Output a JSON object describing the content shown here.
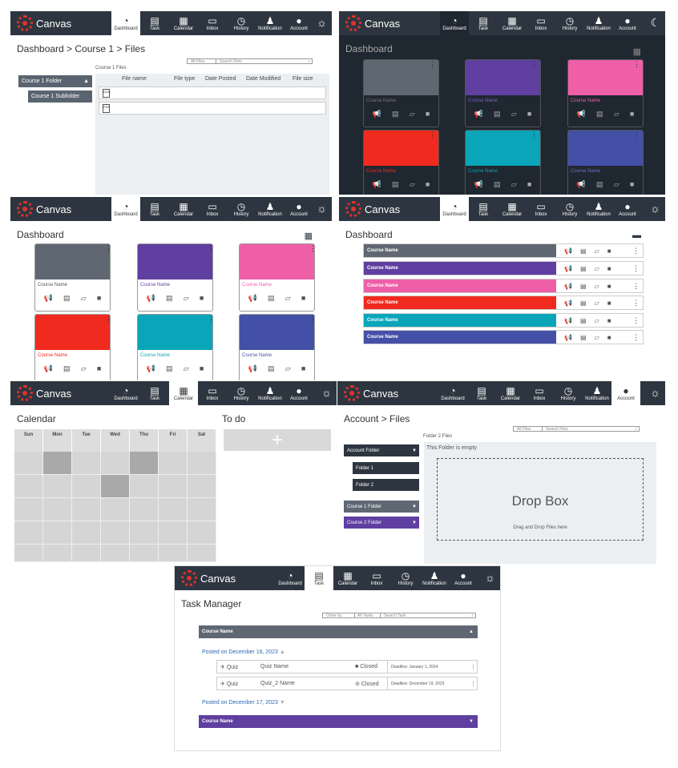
{
  "brand": "Canvas",
  "nav": [
    "Dashboard",
    "Task",
    "Calendar",
    "Inbox",
    "History",
    "Notification",
    "Account"
  ],
  "colors": {
    "nav": "#2d3640",
    "accent_red": "#e0312b"
  },
  "files": {
    "breadcrumb": "Dashboard > Course 1 > Files",
    "folder_heading": "Course 1 Files",
    "search_filter": "All Files",
    "search_placeholder": "Search Files",
    "folder": "Course 1 Folder",
    "subfolder": "Course 1 Subfolder",
    "columns": [
      "File name",
      "File type",
      "Date Posted",
      "Date Modified",
      "File size"
    ],
    "file_icons": [
      "DOC",
      "PDF"
    ]
  },
  "dashboard": {
    "title": "Dashboard",
    "courses": [
      {
        "name": "Course Name",
        "color": "#5f6872",
        "text": "#555"
      },
      {
        "name": "Course Name",
        "color": "#5f3fa0",
        "text": "#5f3fa0"
      },
      {
        "name": "Course Name",
        "color": "#ee5fa8",
        "text": "#ee5fa8"
      },
      {
        "name": "Course Name",
        "color": "#f02a1f",
        "text": "#f02a1f"
      },
      {
        "name": "Course Name",
        "color": "#0aa5b8",
        "text": "#0aa5b8"
      },
      {
        "name": "Course Name",
        "color": "#4450a6",
        "text": "#4450a6"
      }
    ]
  },
  "calendar": {
    "title": "Calendar",
    "days": [
      "Sun",
      "Mon",
      "Tue",
      "Wed",
      "Thu",
      "Fri",
      "Sat"
    ],
    "todo": "To do",
    "add": "+"
  },
  "account": {
    "breadcrumb": "Account > Files",
    "folder_heading": "Folder 2 Files",
    "search_filter": "All Files",
    "search_placeholder": "Search Files",
    "root_folder": "Account Folder",
    "folders": [
      "Folder 1",
      "Folder 2"
    ],
    "course_folders": [
      "Course 1 Folder",
      "Course 2 Folder"
    ],
    "empty": "This Folder is empty",
    "drop_title": "Drop Box",
    "drop_hint": "Drag and Drop Files here"
  },
  "tasks": {
    "title": "Task Manager",
    "order_by": "Order by",
    "filter": "All Tasks",
    "search_placeholder": "Search Task",
    "course1": "Course Name",
    "course2": "Course Name",
    "posted1": "Posted on December 16, 2023",
    "posted2": "Posted on December 17, 2023",
    "rows": [
      {
        "type": "Quiz",
        "name": "Quiz Name",
        "status": "Closed",
        "deadline": "Deadline: January 1, 2024"
      },
      {
        "type": "Quiz",
        "name": "Quiz_2 Name",
        "status": "Closed",
        "deadline": "Deadline: December 19, 2023"
      }
    ]
  }
}
